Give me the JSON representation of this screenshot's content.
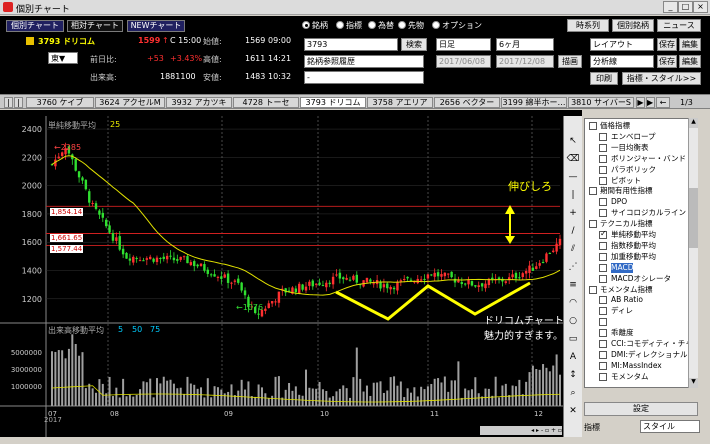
{
  "window": {
    "title": "個別チャート",
    "buttons": [
      "_",
      "□",
      "×"
    ]
  },
  "toolbar": {
    "tabs": [
      "個別チャート",
      "相対チャート",
      "NEWチャート"
    ],
    "radios": [
      "銘柄",
      "指標",
      "為替",
      "先物",
      "オプション"
    ],
    "right_buttons": [
      "時系列",
      "個別銘柄",
      "ニュース"
    ]
  },
  "stock": {
    "code_name": "3793 ドリコム",
    "price": "1599",
    "change_mark": "↑",
    "time": "C 15:00",
    "market": "東▼",
    "prev_label": "前日比:",
    "change": "+53",
    "change_pct": "+3.43%",
    "volume_label": "出来高:",
    "volume": "1881100",
    "open_label": "始値:",
    "open": "1569",
    "open_t": "09:00",
    "high_label": "高値:",
    "high": "1611",
    "high_t": "14:21",
    "low_label": "安値:",
    "low": "1483",
    "low_t": "10:32"
  },
  "search": {
    "code": "3793",
    "search_btn": "検索",
    "history": "銘柄参照履歴",
    "blank": "-"
  },
  "period": {
    "unit": "日足",
    "span": "6ヶ月",
    "from": "2017/06/08",
    "to": "2017/12/08",
    "draw_btn": "描画"
  },
  "layout": {
    "layout": "レイアウト",
    "save1": "保存",
    "edit1": "編集",
    "analysis": "分析線",
    "save2": "保存",
    "edit2": "編集",
    "print": "印刷",
    "style": "指標・スタイル>>"
  },
  "tabs": [
    "3760 ケイブ",
    "3624 アクセルM",
    "3932 アカツキ",
    "4728 トーセ",
    "3793 ドリコム",
    "3758 アエリア",
    "2656 ベクター",
    "3199 綿半ホー…",
    "3810 サイバーS"
  ],
  "tab_page": "1/3",
  "chart": {
    "ma_label": "単純移動平均",
    "ma_period": "25",
    "vol_label": "出来高移動平均",
    "vol_p": [
      "5",
      "50",
      "75"
    ],
    "y_labels": [
      "2400",
      "2200",
      "2000",
      "1800",
      "1600",
      "1400",
      "1200"
    ],
    "v_labels": [
      "5000000",
      "3000000",
      "1000000"
    ],
    "x_labels": [
      "07",
      "08",
      "09",
      "10",
      "11",
      "12"
    ],
    "year": "2017",
    "hlines": [
      "1,854.14",
      "1,661.65",
      "1,577.44"
    ],
    "max_label": "←2285",
    "min_label": "←1076",
    "annot1": "伸びしろ",
    "annot2": "ドリコムチャートが魅力的すぎます。"
  },
  "chart_data": {
    "type": "candlestick",
    "x": [
      "2017-07",
      "2017-08",
      "2017-09",
      "2017-10",
      "2017-11",
      "2017-12"
    ],
    "close": [
      2150,
      1550,
      1250,
      1350,
      1380,
      1599
    ],
    "max": 2285,
    "min": 1076,
    "ylim": [
      1050,
      2450
    ],
    "reference_levels": [
      1854.14,
      1661.65,
      1577.44
    ]
  },
  "indicators": [
    {
      "t": "h",
      "label": "価格指標"
    },
    {
      "t": "i",
      "label": "エンベロープ",
      "c": false
    },
    {
      "t": "i",
      "label": "一目均衡表",
      "c": false
    },
    {
      "t": "i",
      "label": "ボリンジャー・バンド",
      "c": false
    },
    {
      "t": "i",
      "label": "パラボリック",
      "c": false
    },
    {
      "t": "i",
      "label": "ピボット",
      "c": false
    },
    {
      "t": "h",
      "label": "期間有用性指標"
    },
    {
      "t": "i",
      "label": "DPO",
      "c": false
    },
    {
      "t": "i",
      "label": "サイコロジカルライン",
      "c": false
    },
    {
      "t": "h",
      "label": "テクニカル指標"
    },
    {
      "t": "i",
      "label": "単純移動平均",
      "c": true
    },
    {
      "t": "i",
      "label": "指数移動平均",
      "c": false
    },
    {
      "t": "i",
      "label": "加重移動平均",
      "c": false
    },
    {
      "t": "i",
      "label": "MACD",
      "c": false,
      "sel": true
    },
    {
      "t": "i",
      "label": "MACDオシレータ",
      "c": false
    },
    {
      "t": "h",
      "label": "モメンタム指標"
    },
    {
      "t": "i",
      "label": "AB Ratio",
      "c": false
    },
    {
      "t": "i",
      "label": "ディレ",
      "c": false
    },
    {
      "t": "i",
      "label": "",
      "c": false
    },
    {
      "t": "i",
      "label": "乖離度",
      "c": false
    },
    {
      "t": "i",
      "label": "CCI:コモディティ・チャ",
      "c": false
    },
    {
      "t": "i",
      "label": "DMI:ディレクショナル",
      "c": false
    },
    {
      "t": "i",
      "label": "MI:MassIndex",
      "c": false
    },
    {
      "t": "i",
      "label": "モメンタム",
      "c": false
    }
  ],
  "panel": {
    "settings": "設定",
    "ind_label": "指標",
    "style_label": "スタイル"
  }
}
